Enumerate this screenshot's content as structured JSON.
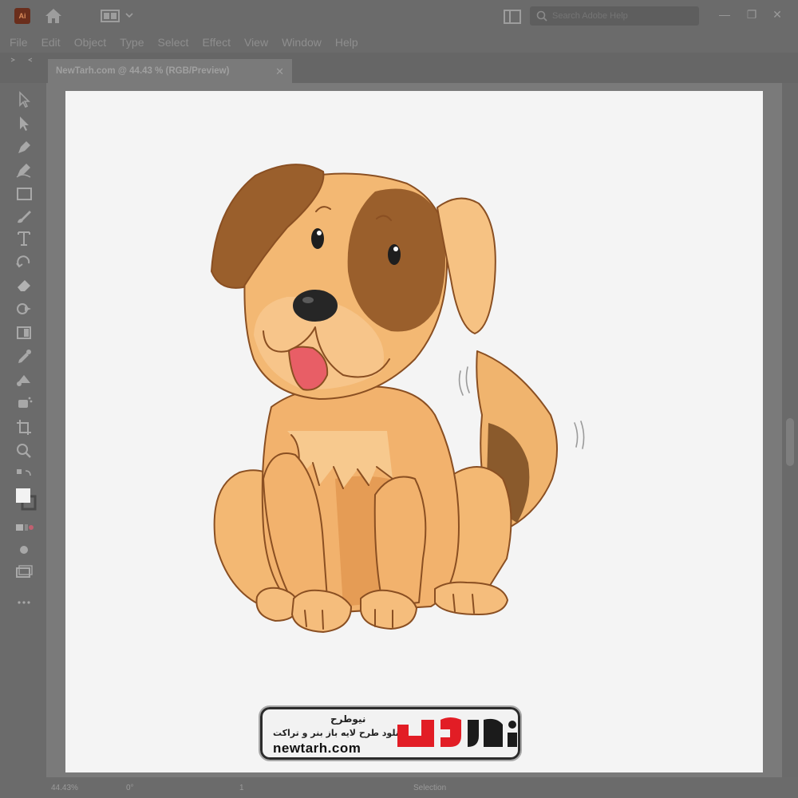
{
  "app": {
    "logo_text": "Ai"
  },
  "search": {
    "placeholder": "Search Adobe Help"
  },
  "menu": [
    "File",
    "Edit",
    "Object",
    "Type",
    "Select",
    "Effect",
    "View",
    "Window",
    "Help"
  ],
  "document": {
    "tab_label": "NewTarh.com @ 44.43 % (RGB/Preview)",
    "close_glyph": "✕"
  },
  "window_controls": {
    "minimize": "—",
    "restore": "❐",
    "close": "✕"
  },
  "status": {
    "zoom": "44.43%",
    "rotation": "0°",
    "artboard": "1",
    "tool": "Selection"
  },
  "colors": {
    "chrome": "#6b6b6b",
    "workspace": "#7a7a7a",
    "artboard": "#f4f4f4",
    "brand_red": "#e21d25"
  },
  "watermark": {
    "line1": "نیوطرح",
    "line2": "دانلود طرح لایه باز بنر و تراکت",
    "url": "newtarh.com",
    "logo_text": "نیوطرح"
  },
  "tools": [
    "selection-icon",
    "direct-selection-icon",
    "pen-icon",
    "curvature-icon",
    "rectangle-icon",
    "paintbrush-icon",
    "type-icon",
    "rotate-icon",
    "eraser-icon",
    "shape-builder-icon",
    "gradient-icon",
    "eyedropper-icon",
    "blend-icon",
    "symbol-sprayer-icon",
    "artboard-icon",
    "zoom-icon"
  ]
}
